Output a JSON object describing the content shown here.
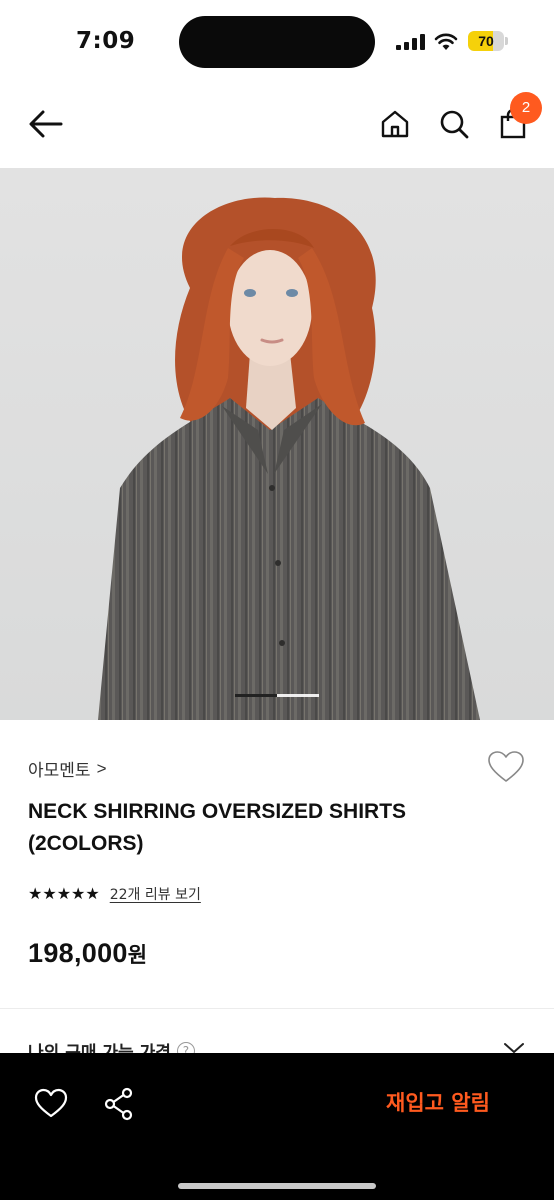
{
  "status_bar": {
    "time": "7:09",
    "battery_level": "70",
    "battery_fraction": 0.7,
    "battery_color": "#f5d10a"
  },
  "header": {
    "back_icon": "arrow-left-icon",
    "home_icon": "home-icon",
    "search_icon": "search-icon",
    "bag_icon": "shopping-bag-icon",
    "cart_count": "2",
    "badge_color": "#ff5a1f"
  },
  "gallery": {
    "current_index": 1,
    "total": 2
  },
  "product": {
    "brand": "아모멘토",
    "brand_chevron": ">",
    "title": "NECK SHIRRING OVERSIZED SHIRTS (2COLORS)",
    "rating_stars": 5,
    "stars": "★★★★★",
    "review_link": "22개 리뷰 보기",
    "price": "198,000",
    "price_unit": "원",
    "wish_icon": "heart-outline-icon"
  },
  "benefit": {
    "label": "나의 구매 가능 가격",
    "help": "?"
  },
  "bottom_bar": {
    "like_icon": "heart-outline-icon",
    "share_icon": "share-icon",
    "restock_label": "재입고 알림",
    "accent_color": "#ff5a1f"
  }
}
